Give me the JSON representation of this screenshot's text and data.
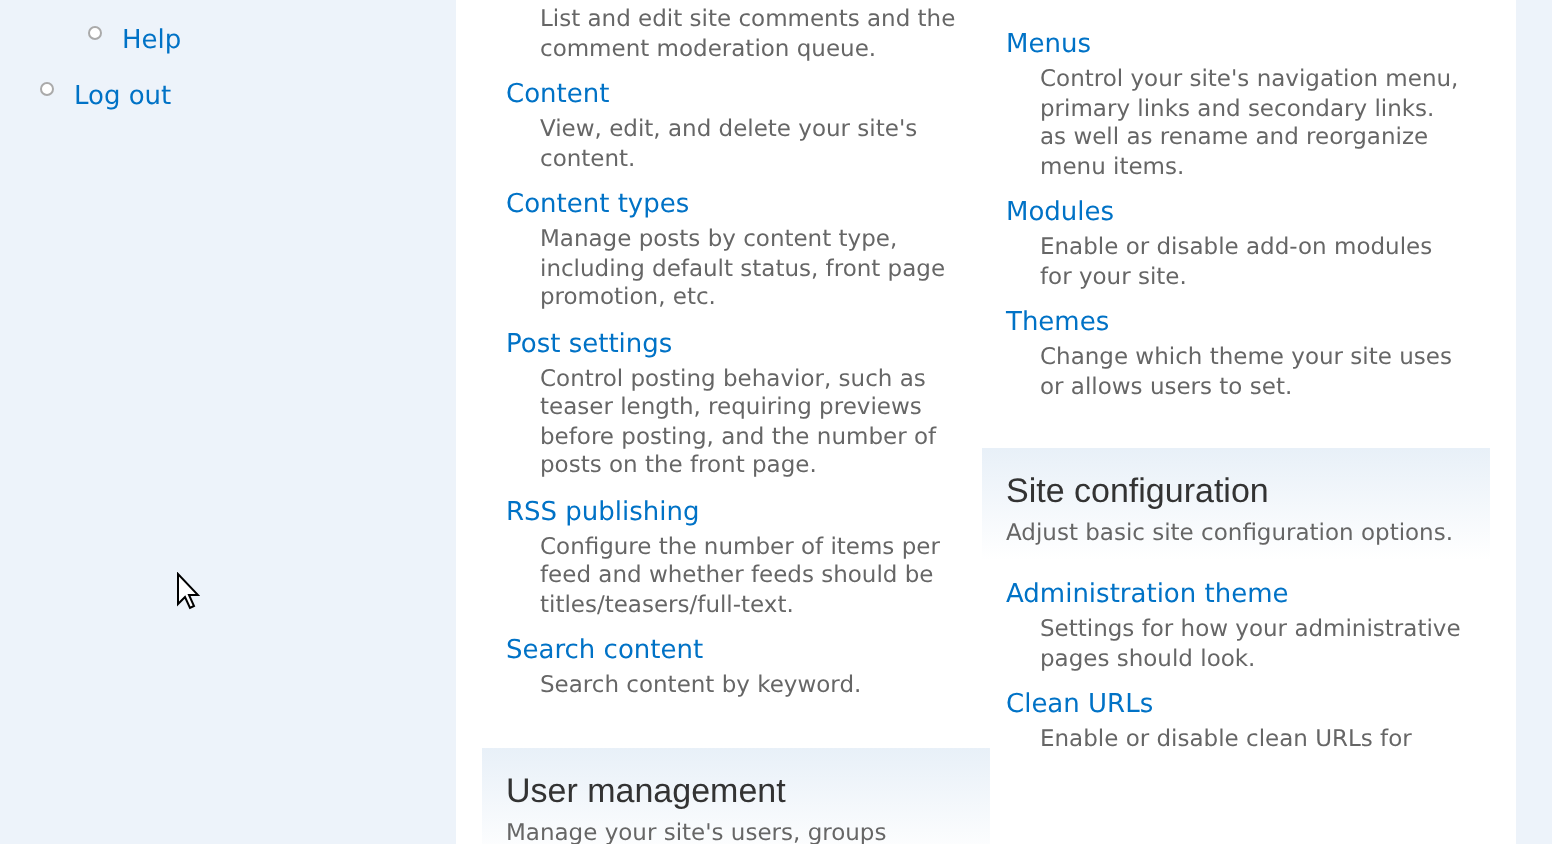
{
  "sidebar": {
    "submenu_items": [
      {
        "label": "Help"
      }
    ],
    "items": [
      {
        "label": "Log out"
      }
    ]
  },
  "columns": [
    {
      "entries": [
        {
          "kind": "description",
          "text": "List and edit site comments and the comment moderation queue."
        },
        {
          "kind": "item",
          "title": "Content",
          "text": "View, edit, and delete your site's content."
        },
        {
          "kind": "item",
          "title": "Content types",
          "text": "Manage posts by content type, including default status, front page promotion, etc."
        },
        {
          "kind": "item",
          "title": "Post settings",
          "text": "Control posting behavior, such as teaser length, requiring previews before posting, and the number of posts on the front page."
        },
        {
          "kind": "item",
          "title": "RSS publishing",
          "text": "Configure the number of items per feed and whether feeds should be titles/teasers/full-text."
        },
        {
          "kind": "item",
          "title": "Search content",
          "text": "Search content by keyword."
        },
        {
          "kind": "section",
          "title": "User management",
          "text": "Manage your site's users, groups"
        }
      ]
    },
    {
      "entries": [
        {
          "kind": "item",
          "title": "Menus",
          "text": "Control your site's navigation menu, primary links and secondary links. as well as rename and reorganize menu items."
        },
        {
          "kind": "item",
          "title": "Modules",
          "text": "Enable or disable add-on modules for your site."
        },
        {
          "kind": "item",
          "title": "Themes",
          "text": "Change which theme your site uses or allows users to set."
        },
        {
          "kind": "section",
          "title": "Site configuration",
          "text": "Adjust basic site configuration options."
        },
        {
          "kind": "item",
          "title": "Administration theme",
          "text": "Settings for how your administrative pages should look."
        },
        {
          "kind": "item",
          "title": "Clean URLs",
          "text": "Enable or disable clean URLs for"
        }
      ]
    }
  ]
}
